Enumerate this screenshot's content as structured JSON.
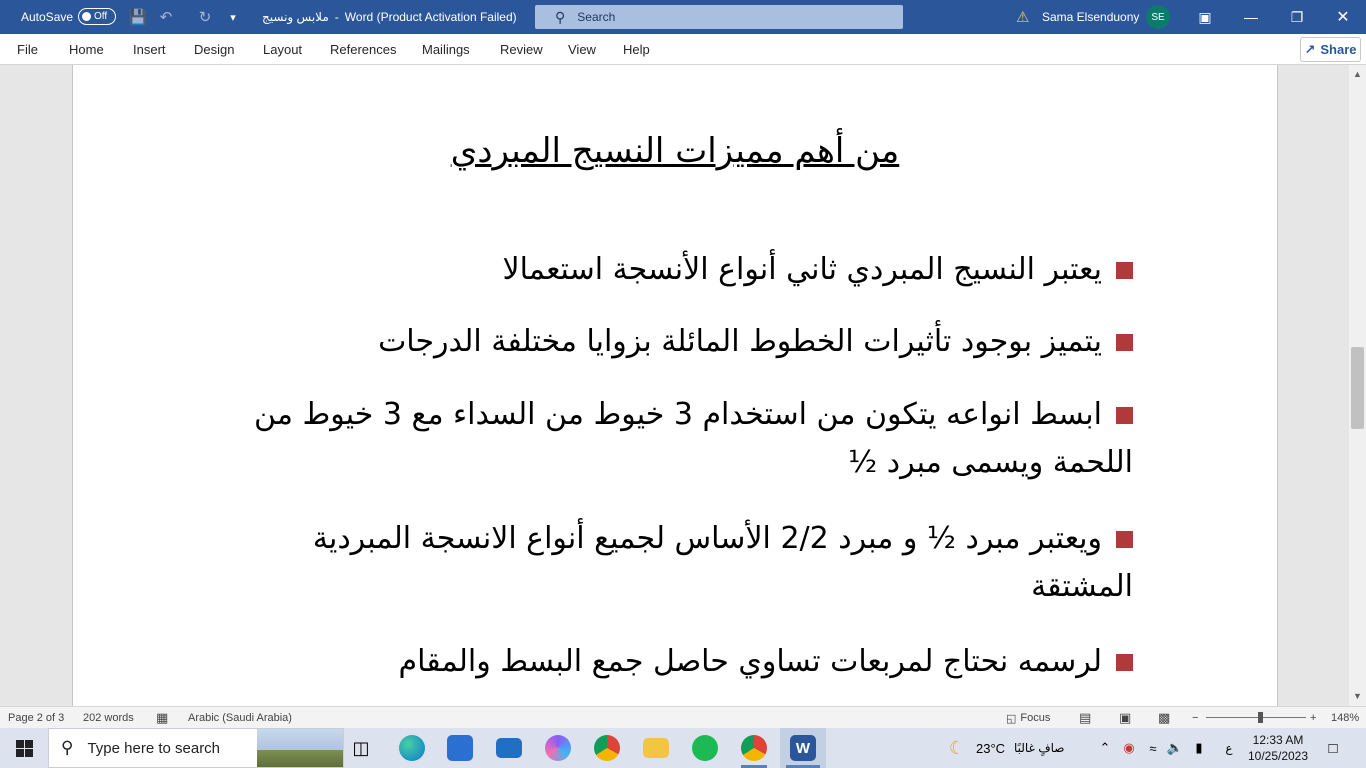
{
  "titlebar": {
    "autosave_label": "AutoSave",
    "autosave_state": "Off",
    "doc_name": "ملابس ونسيج",
    "separator": "-",
    "app_title": "Word (Product Activation Failed)",
    "search_placeholder": "Search",
    "user_name": "Sama Elsenduony",
    "user_initials": "SE"
  },
  "ribbon": {
    "tabs": [
      "File",
      "Home",
      "Insert",
      "Design",
      "Layout",
      "References",
      "Mailings",
      "Review",
      "View",
      "Help"
    ],
    "share_label": "Share"
  },
  "document": {
    "heading": "من أهم مميزات النسيج المبردي",
    "bullet_color": "#b03a3a",
    "bullets": [
      "يعتبر النسيج المبردي ثاني أنواع الأنسجة استعمالا",
      "يتميز بوجود تأثيرات الخطوط المائلة بزوايا مختلفة الدرجات",
      "ابسط انواعه يتكون من استخدام 3 خيوط من السداء مع 3 خيوط من اللحمة ويسمى مبرد ½",
      "ويعتبر مبرد ½ و مبرد 2/2 الأساس لجميع أنواع الانسجة المبردية المشتقة",
      "لرسمه نحتاج لمربعات تساوي حاصل جمع البسط والمقام"
    ]
  },
  "statusbar": {
    "page": "Page 2 of 3",
    "words": "202 words",
    "language": "Arabic (Saudi Arabia)",
    "focus": "Focus",
    "zoom_minus": "−",
    "zoom_plus": "+",
    "zoom": "148%",
    "zoom_level_percent": 148
  },
  "taskbar": {
    "search_placeholder": "Type here to search",
    "weather_temp": "23°C",
    "weather_text": "صافٍ غالبًا",
    "input_lang": "ع",
    "time": "12:33 AM",
    "date": "10/25/2023"
  },
  "colors": {
    "word_blue": "#2b579a",
    "taskbar_bg": "#dde3ee"
  }
}
